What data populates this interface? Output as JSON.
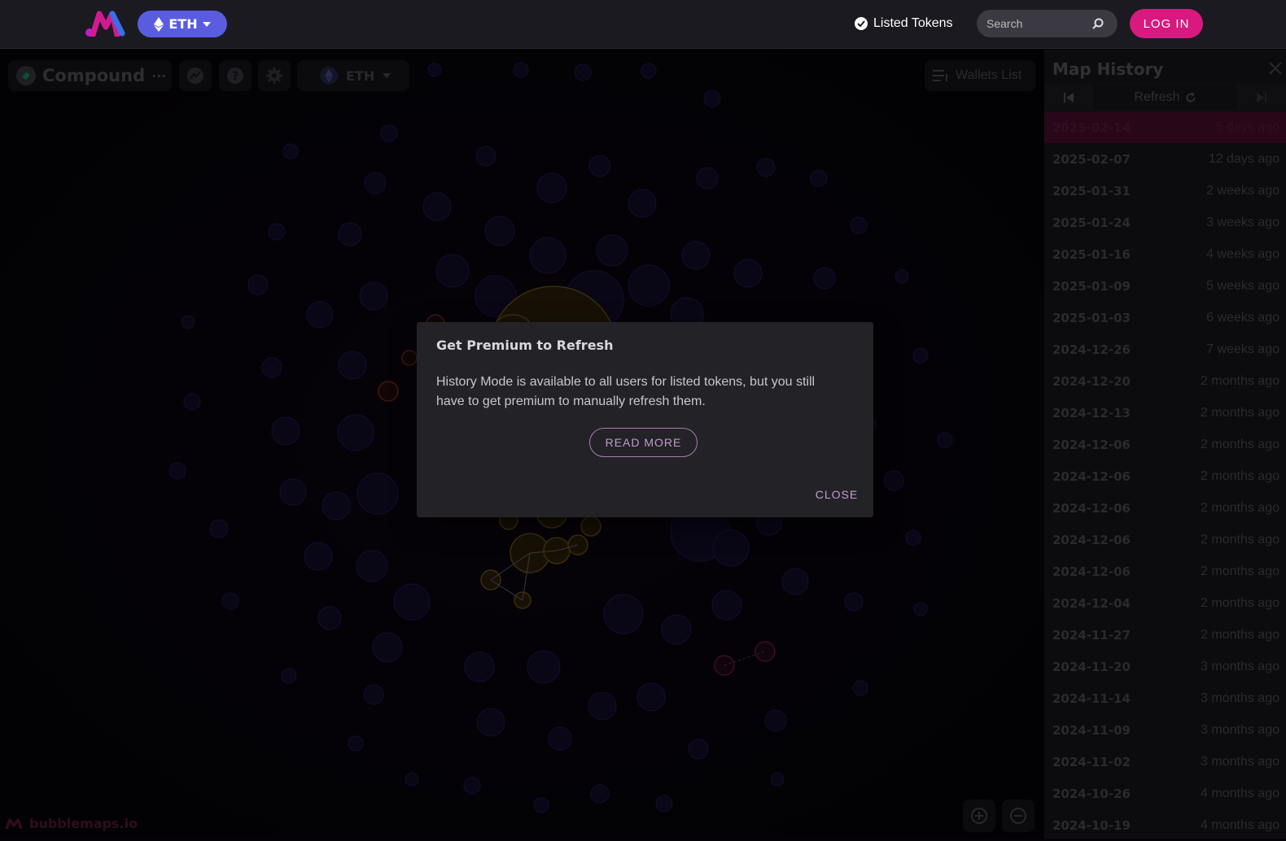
{
  "header": {
    "chain_label": "ETH",
    "listed_tokens_label": "Listed Tokens",
    "search_placeholder": "Search",
    "login_label": "LOG IN"
  },
  "toolbar": {
    "token_name": "Compound",
    "token_more": "···",
    "network_label": "ETH",
    "wallets_list_label": "Wallets List"
  },
  "brand": {
    "text": "bubblemaps.io"
  },
  "history_panel": {
    "title": "Map History",
    "refresh_label": "Refresh",
    "items": [
      {
        "date": "2025-02-14",
        "ago": "5 days ago"
      },
      {
        "date": "2025-02-07",
        "ago": "12 days ago"
      },
      {
        "date": "2025-01-31",
        "ago": "2 weeks ago"
      },
      {
        "date": "2025-01-24",
        "ago": "3 weeks ago"
      },
      {
        "date": "2025-01-16",
        "ago": "4 weeks ago"
      },
      {
        "date": "2025-01-09",
        "ago": "5 weeks ago"
      },
      {
        "date": "2025-01-03",
        "ago": "6 weeks ago"
      },
      {
        "date": "2024-12-26",
        "ago": "7 weeks ago"
      },
      {
        "date": "2024-12-20",
        "ago": "2 months ago"
      },
      {
        "date": "2024-12-13",
        "ago": "2 months ago"
      },
      {
        "date": "2024-12-06",
        "ago": "2 months ago"
      },
      {
        "date": "2024-12-06",
        "ago": "2 months ago"
      },
      {
        "date": "2024-12-06",
        "ago": "2 months ago"
      },
      {
        "date": "2024-12-06",
        "ago": "2 months ago"
      },
      {
        "date": "2024-12-06",
        "ago": "2 months ago"
      },
      {
        "date": "2024-12-04",
        "ago": "2 months ago"
      },
      {
        "date": "2024-11-27",
        "ago": "2 months ago"
      },
      {
        "date": "2024-11-20",
        "ago": "3 months ago"
      },
      {
        "date": "2024-11-14",
        "ago": "3 months ago"
      },
      {
        "date": "2024-11-09",
        "ago": "3 months ago"
      },
      {
        "date": "2024-11-02",
        "ago": "3 months ago"
      },
      {
        "date": "2024-10-26",
        "ago": "4 months ago"
      },
      {
        "date": "2024-10-19",
        "ago": "4 months ago"
      }
    ]
  },
  "modal": {
    "title": "Get Premium to Refresh",
    "body": "History Mode is available to all users for listed tokens, but you still have to get premium to manually refresh them.",
    "read_more_label": "READ MORE",
    "close_label": "CLOSE"
  },
  "colors": {
    "accent_pink": "#d8197f",
    "chain_blue": "#5a5ce0",
    "bubble_purple": "#2a1a55",
    "bubble_gold": "#8a6a1a",
    "bubble_red": "#8a2a1a"
  }
}
